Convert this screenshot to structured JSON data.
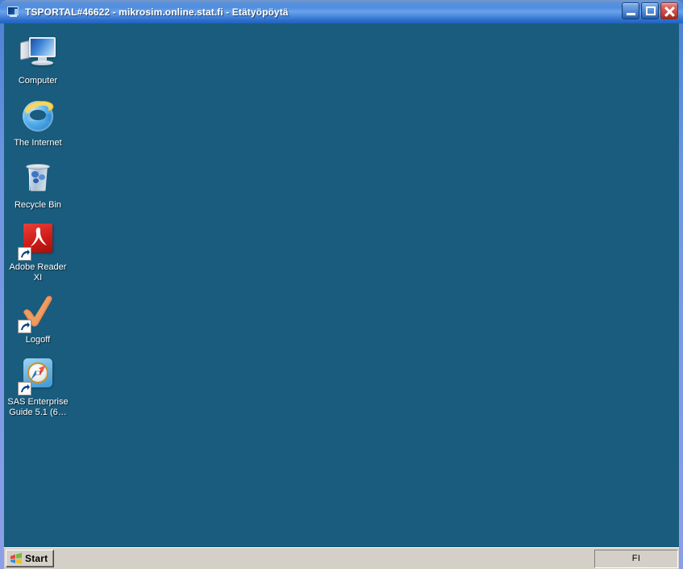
{
  "window": {
    "title": "TSPORTAL#46622 - mikrosim.online.stat.fi - Etätyöpöytä",
    "title_icon": "remote-desktop-icon",
    "controls": {
      "minimize": "Minimize",
      "maximize": "Maximize",
      "close": "Close"
    },
    "frame_color": "#7f8fe0",
    "titlebar_color": "#2064c5"
  },
  "desktop": {
    "background_color": "#195c7d",
    "icons": [
      {
        "label": "Computer",
        "icon": "computer-monitor-icon",
        "shortcut": false
      },
      {
        "label": "The Internet",
        "icon": "internet-explorer-icon",
        "shortcut": false
      },
      {
        "label": "Recycle Bin",
        "icon": "recycle-bin-icon",
        "shortcut": false
      },
      {
        "label": "Adobe Reader\nXI",
        "icon": "adobe-reader-icon",
        "shortcut": true
      },
      {
        "label": "Logoff",
        "icon": "checkmark-icon",
        "shortcut": true
      },
      {
        "label": "SAS Enterprise\nGuide 5.1 (6…",
        "icon": "sas-enterprise-guide-icon",
        "shortcut": true
      }
    ]
  },
  "taskbar": {
    "start_label": "Start",
    "start_icon": "windows-flag-icon",
    "tray": {
      "language": "FI"
    }
  }
}
